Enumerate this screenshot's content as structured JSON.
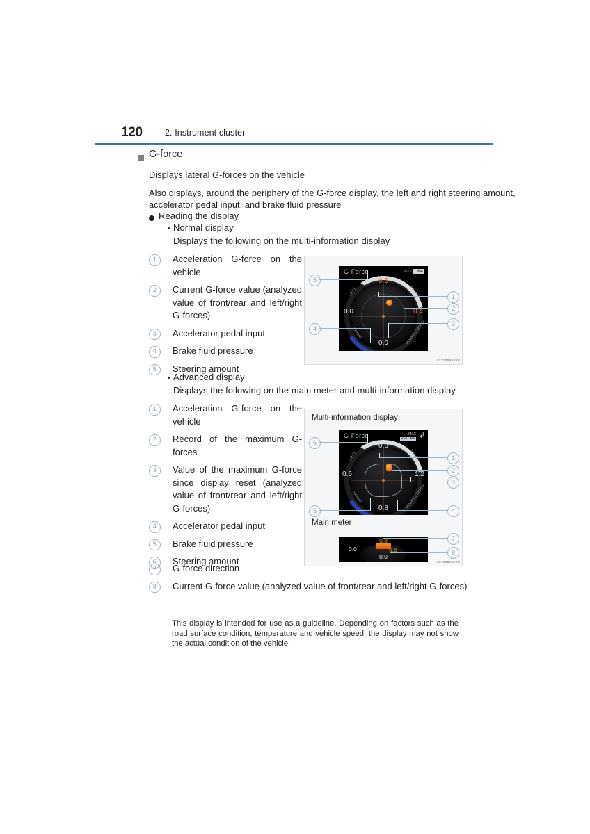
{
  "page": {
    "number": "120",
    "chapter": "2. Instrument cluster",
    "rule_color": "#3d7d95"
  },
  "section": {
    "heading": "G-force",
    "intro_1": "Displays lateral G-forces on the vehicle",
    "intro_2": "Also displays, around the periphery of the G-force display, the left and right steering amount, accelerator pedal input, and brake fluid pressure",
    "reading_the_display": "Reading the display"
  },
  "normal_display": {
    "label": "Normal display",
    "subtitle": "Displays the following on the multi-information display",
    "items": [
      {
        "num": "1",
        "text": "Acceleration G-force on the vehicle"
      },
      {
        "num": "2",
        "text": "Current G-force value (analyzed value of front/rear and left/right G-forces)"
      },
      {
        "num": "3",
        "text": "Accelerator pedal input"
      },
      {
        "num": "4",
        "text": "Brake fluid pressure"
      },
      {
        "num": "5",
        "text": "Steering amount"
      }
    ]
  },
  "advanced_display": {
    "label": "Advanced display",
    "subtitle": "Displays the following on the main meter and multi-information display",
    "items": [
      {
        "num": "1",
        "text": "Acceleration G-force on the vehicle"
      },
      {
        "num": "2",
        "text": "Record of the maximum G-forces"
      },
      {
        "num": "3",
        "text": "Value of the maximum G-force since display reset (analyzed value of front/rear and left/right G-forces)"
      },
      {
        "num": "4",
        "text": "Accelerator pedal input"
      },
      {
        "num": "5",
        "text": "Brake fluid pressure"
      },
      {
        "num": "6",
        "text": "Steering amount"
      }
    ],
    "wide_items": [
      {
        "num": "7",
        "text": "G-force direction"
      },
      {
        "num": "8",
        "text": "Current G-force value (analyzed value of front/rear and left/right G-forces)"
      }
    ]
  },
  "note": "This display is intended for use as a guideline. Depending on factors such as the road surface condition, temperature and vehicle speed, the display may not show the actual condition of the vehicle.",
  "figure_normal": {
    "code": "CLY20BK22RE",
    "screen": {
      "title": "G-Force",
      "max_label": "MAX",
      "max_value": "1.04",
      "ring_labels": {
        "left": "LEFT",
        "right": "RIGHT",
        "brake": "BRAKE",
        "accel": "ACCELERATOR"
      },
      "values": {
        "top": "0.5",
        "left": "0.0",
        "right": "0.4",
        "bottom": "0.0"
      }
    },
    "callouts": [
      "1",
      "2",
      "3",
      "4",
      "5"
    ]
  },
  "figure_advanced": {
    "code": "CLY20BK29SE",
    "mid_label": "Multi-information display",
    "main_label": "Main meter",
    "screen": {
      "title": "G-Force",
      "mode_label": "MAX",
      "mode_value": "RETURN",
      "return_icon": "return-arrow-icon",
      "ring_labels": {
        "left": "LEFT",
        "right": "RIGHT",
        "brake": "BRAKE",
        "accel": "ACCELERATOR"
      },
      "values": {
        "top": "0.8",
        "left": "0.6",
        "right": "1.2",
        "bottom": "0.8"
      }
    },
    "main_meter": {
      "values": {
        "top": "0.8",
        "left": "0.0",
        "right": "0.8",
        "bottom": "0.0"
      }
    },
    "callouts": [
      "1",
      "2",
      "3",
      "4",
      "5",
      "6",
      "7",
      "8"
    ]
  }
}
